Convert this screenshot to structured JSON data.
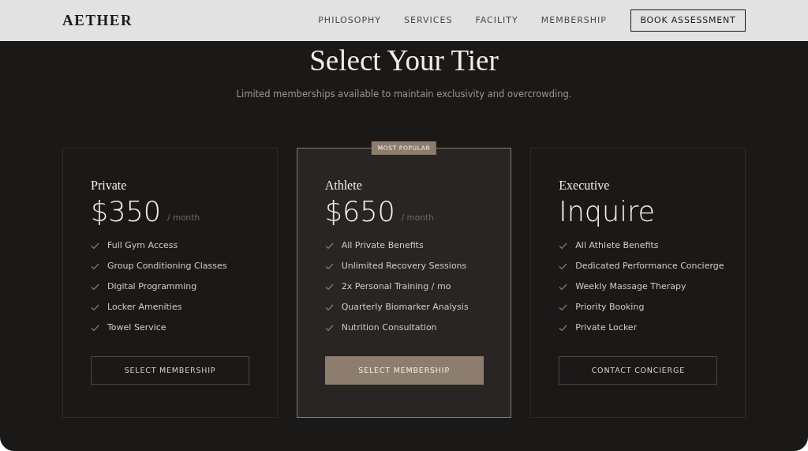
{
  "header": {
    "logo": "AETHER",
    "nav": [
      {
        "label": "PHILOSOPHY"
      },
      {
        "label": "SERVICES"
      },
      {
        "label": "FACILITY"
      },
      {
        "label": "MEMBERSHIP"
      }
    ],
    "cta": "BOOK ASSESSMENT"
  },
  "title": "Select Your Tier",
  "subtitle": "Limited memberships available to maintain exclusivity and overcrowding.",
  "tiers": [
    {
      "name": "Private",
      "price": "$350",
      "period": "/ month",
      "featured": false,
      "features": [
        "Full Gym Access",
        "Group Conditioning Classes",
        "Digital Programming",
        "Locker Amenities",
        "Towel Service"
      ],
      "button": "SELECT MEMBERSHIP"
    },
    {
      "name": "Athlete",
      "price": "$650",
      "period": "/ month",
      "featured": true,
      "badge": "MOST POPULAR",
      "features": [
        "All Private Benefits",
        "Unlimited Recovery Sessions",
        "2x Personal Training / mo",
        "Quarterly Biomarker Analysis",
        "Nutrition Consultation"
      ],
      "button": "SELECT MEMBERSHIP"
    },
    {
      "name": "Executive",
      "price": "Inquire",
      "featured": false,
      "features": [
        "All Athlete Benefits",
        "Dedicated Performance Concierge",
        "Weekly Massage Therapy",
        "Priority Booking",
        "Private Locker"
      ],
      "button": "CONTACT CONCIERGE"
    }
  ]
}
